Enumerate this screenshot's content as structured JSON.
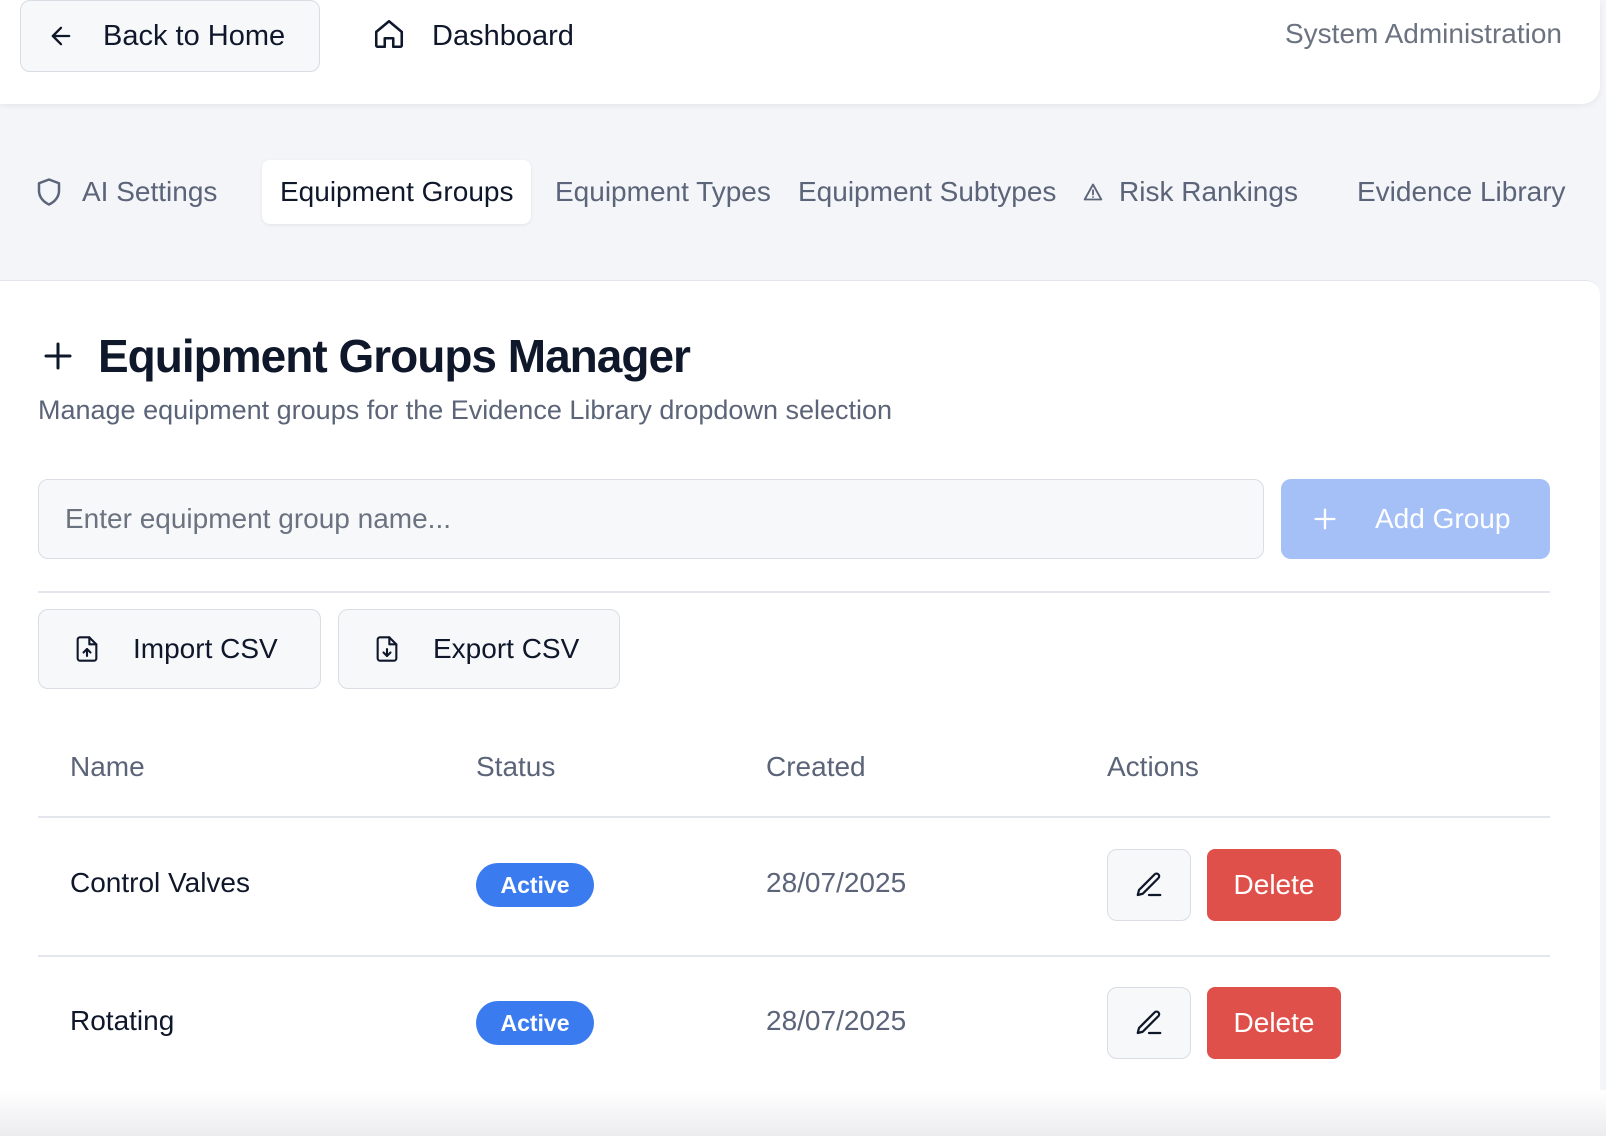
{
  "header": {
    "back_label": "Back to Home",
    "dashboard_label": "Dashboard",
    "section_label": "System Administration"
  },
  "tabs": [
    {
      "label": "AI Settings",
      "icon": "shield-icon",
      "active": false
    },
    {
      "label": "Equipment Groups",
      "active": true
    },
    {
      "label": "Equipment Types",
      "active": false
    },
    {
      "label": "Equipment Subtypes",
      "active": false
    },
    {
      "label": "Risk Rankings",
      "icon": "warning-icon",
      "active": false
    },
    {
      "label": "Evidence Library",
      "active": false
    }
  ],
  "manager": {
    "title": "Equipment Groups Manager",
    "subtitle": "Manage equipment groups for the Evidence Library dropdown selection",
    "input_placeholder": "Enter equipment group name...",
    "input_value": "",
    "add_label": "Add Group",
    "import_label": "Import CSV",
    "export_label": "Export CSV"
  },
  "table": {
    "columns": [
      "Name",
      "Status",
      "Created",
      "Actions"
    ],
    "rows": [
      {
        "name": "Control Valves",
        "status": "Active",
        "created": "28/07/2025",
        "delete_label": "Delete"
      },
      {
        "name": "Rotating",
        "status": "Active",
        "created": "28/07/2025",
        "delete_label": "Delete"
      }
    ]
  },
  "colors": {
    "accent": "#3b7bf0",
    "add_button_disabled": "#a5c0f6",
    "danger": "#e0504a",
    "muted_text": "#5b6478"
  }
}
